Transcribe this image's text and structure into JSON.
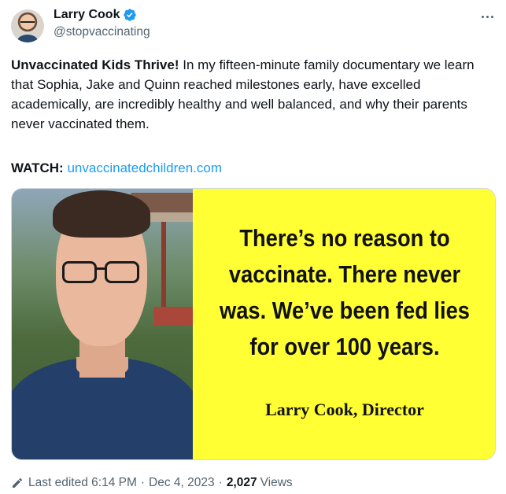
{
  "author": {
    "name": "Larry Cook",
    "handle": "@stopvaccinating"
  },
  "post": {
    "headline": "Unvaccinated Kids Thrive!",
    "text": " In my fifteen-minute family documentary we learn that Sophia, Jake and Quinn reached milestones early, have excelled academically, are incredibly healthy and well balanced, and why their parents never vaccinated them.",
    "watch_label": "WATCH:",
    "link": "unvaccinatedchildren.com"
  },
  "media": {
    "quote": "There’s no reason to vaccinate. There never was. We’ve been fed lies for over 100 years.",
    "signature": "Larry Cook, Director",
    "quote_bg": "#ffff33"
  },
  "meta": {
    "edited_label": "Last edited 6:14 PM",
    "date": "Dec 4, 2023",
    "view_count": "2,027",
    "views_label": "Views"
  },
  "colors": {
    "link": "#1d9bf0",
    "muted": "#536471",
    "text": "#0f1419"
  }
}
